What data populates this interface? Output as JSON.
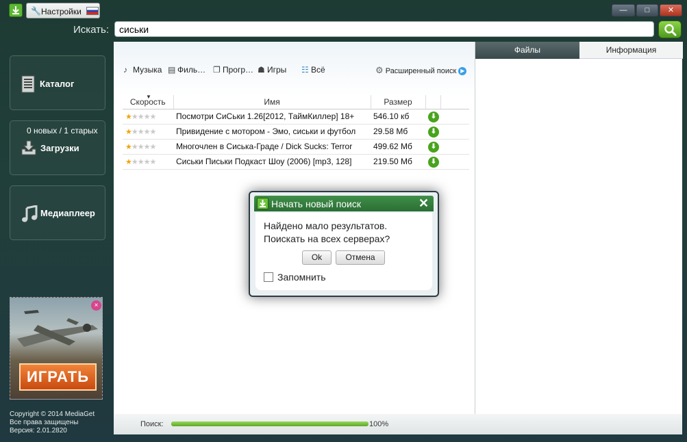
{
  "titlebar": {
    "settings_label": "Настройки",
    "minimize_glyph": "—",
    "maximize_glyph": "□",
    "close_glyph": "✕"
  },
  "search": {
    "label": "Искать:",
    "value": "сиськи"
  },
  "sidebar": {
    "catalog_label": "Каталог",
    "downloads_count": "0 новых / 1 старых",
    "downloads_label": "Загрузки",
    "player_label": "Медиаплеер"
  },
  "ad": {
    "play_label": "ИГРАТЬ",
    "close_glyph": "×"
  },
  "copyright": {
    "line1": "Copyright © 2014 MediaGet",
    "line2": "Все права защищены",
    "line3": "Версия: 2.01.2820"
  },
  "filters": {
    "music": "Музыка",
    "films": "Филь…",
    "programs": "Прогр…",
    "games": "Игры",
    "all": "Всё",
    "advanced": "Расширенный поиск"
  },
  "table": {
    "columns": {
      "speed": "Скорость",
      "name": "Имя",
      "size": "Размер"
    },
    "rows": [
      {
        "name": "Посмотри СиСьки 1.26[2012, ТаймКиллер] 18+",
        "size": "546.10 кб",
        "stars": 1
      },
      {
        "name": "Привидение с мотором - Эмо, сиськи и футбол",
        "size": "29.58 Мб",
        "stars": 1
      },
      {
        "name": "Многочлен в Сиська-Граде / Dick Sucks: Terror",
        "size": "499.62 Мб",
        "stars": 1
      },
      {
        "name": "Сиськи Письки Подкаст Шоу (2006) [mp3, 128]",
        "size": "219.50 Мб",
        "stars": 1
      }
    ]
  },
  "right_panel": {
    "tab_files": "Файлы",
    "tab_info": "Информация"
  },
  "status": {
    "label": "Поиск:",
    "progress": 1.0,
    "percent_text": "100%"
  },
  "dialog": {
    "title": "Начать новый поиск",
    "close_glyph": "✕",
    "line1": "Найдено мало результатов.",
    "line2": "Поискать на всех серверах?",
    "ok_label": "Ok",
    "cancel_label": "Отмена",
    "remember_label": "Запомнить",
    "remember_checked": false
  },
  "colors": {
    "accent_green": "#47a41c",
    "window_bg": "#213f3a",
    "star_on": "#f1a40c"
  }
}
